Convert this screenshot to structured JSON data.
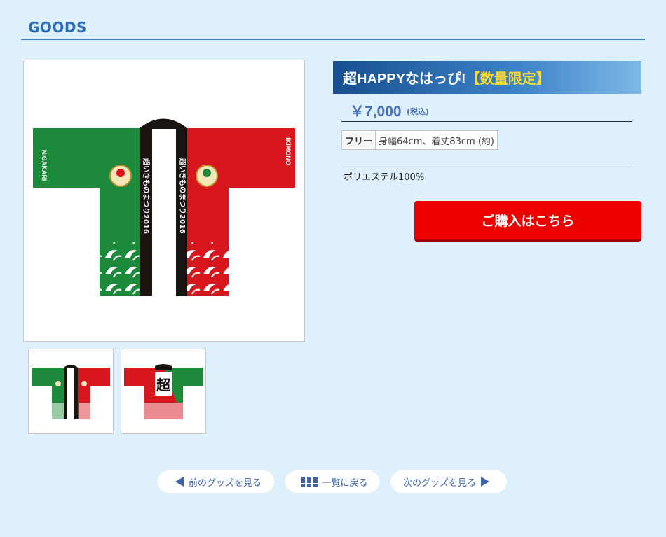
{
  "section": {
    "title": "GOODS"
  },
  "product": {
    "name": "超HAPPYなはっぴ!",
    "limited": "【数量限定】",
    "price": "￥7,000",
    "tax_note": "(税込)",
    "size_label": "フリー",
    "size_value": "身幅64cm、着丈83cm (約)",
    "material": "ポリエステル100%",
    "buy_label": "ご購入はこちら"
  },
  "happi": {
    "left_sleeve_text": "NIGAKARI",
    "right_sleeve_text": "IKIMONO",
    "collar_text": "超いきものまつり2016",
    "back_kanji": "超",
    "colors": {
      "green": "#1d8a3b",
      "red": "#d7161e",
      "collar": "#1a1410"
    }
  },
  "nav": {
    "prev_label": "前のグッズを見る",
    "list_label": "一覧に戻る",
    "next_label": "次のグッズを見る"
  },
  "colors": {
    "accent": "#2d6fb7",
    "buy": "#ec0000",
    "limited": "#ffdb2a",
    "background": "#def0fb"
  }
}
